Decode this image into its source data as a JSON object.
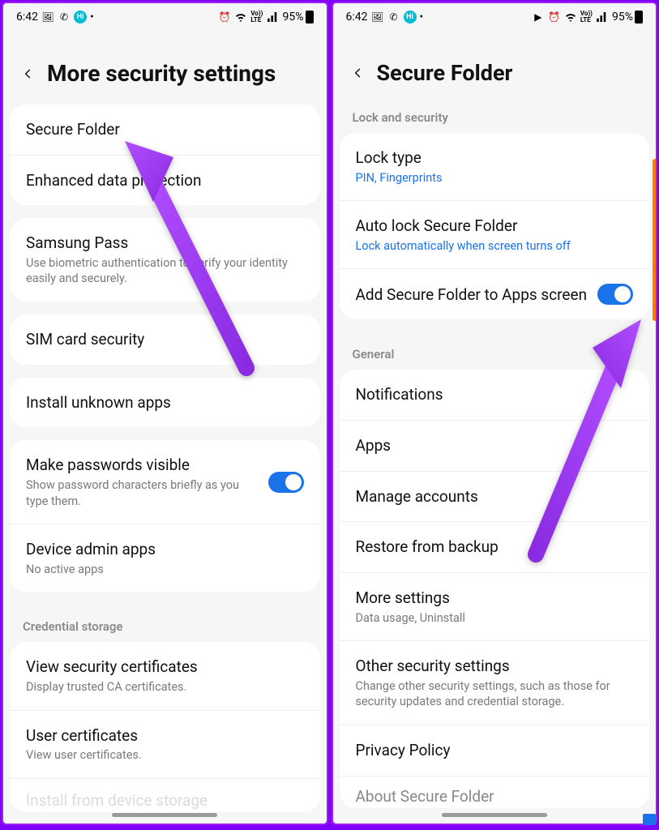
{
  "status": {
    "time": "6:42",
    "battery": "95%",
    "icons_left": [
      "image-icon",
      "whatsapp-icon",
      "hi-icon"
    ],
    "icons_right_a": [
      "alarm-icon",
      "wifi-icon",
      "volte-icon",
      "signal-icon"
    ],
    "icons_right_b": [
      "youtube-icon",
      "alarm-icon",
      "wifi-icon",
      "volte-icon",
      "signal-icon"
    ]
  },
  "left": {
    "title": "More security settings",
    "group1": [
      {
        "title": "Secure Folder"
      },
      {
        "title": "Enhanced data protection"
      }
    ],
    "group2": [
      {
        "title": "Samsung Pass",
        "sub": "Use biometric authentication to verify your identity easily and securely."
      }
    ],
    "group3": [
      {
        "title": "SIM card security"
      }
    ],
    "group4": [
      {
        "title": "Install unknown apps"
      }
    ],
    "group5": [
      {
        "title": "Make passwords visible",
        "sub": "Show password characters briefly as you type them.",
        "toggle": true
      },
      {
        "title": "Device admin apps",
        "sub": "No active apps"
      }
    ],
    "cred_header": "Credential storage",
    "group6": [
      {
        "title": "View security certificates",
        "sub": "Display trusted CA certificates."
      },
      {
        "title": "User certificates",
        "sub": "View user certificates."
      },
      {
        "title": "Install from device storage"
      }
    ]
  },
  "right": {
    "title": "Secure Folder",
    "lock_header": "Lock and security",
    "lock": [
      {
        "title": "Lock type",
        "sub": "PIN, Fingerprints",
        "link": true
      },
      {
        "title": "Auto lock Secure Folder",
        "sub": "Lock automatically when screen turns off",
        "link": true
      },
      {
        "title": "Add Secure Folder to Apps screen",
        "toggle": true
      }
    ],
    "general_header": "General",
    "general": [
      {
        "title": "Notifications"
      },
      {
        "title": "Apps"
      },
      {
        "title": "Manage accounts"
      },
      {
        "title": "Restore from backup"
      },
      {
        "title": "More settings",
        "sub": "Data usage, Uninstall"
      },
      {
        "title": "Other security settings",
        "sub": "Change other security settings, such as those for security updates and credential storage."
      },
      {
        "title": "Privacy Policy"
      },
      {
        "title": "About Secure Folder"
      }
    ]
  }
}
